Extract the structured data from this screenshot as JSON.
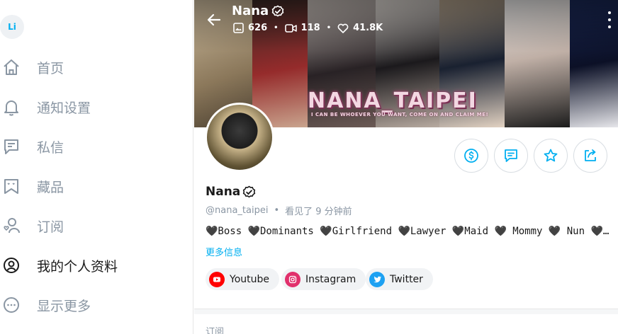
{
  "sidebar": {
    "avatar_initials": "Li",
    "items": [
      {
        "label": "首页",
        "icon": "home-icon"
      },
      {
        "label": "通知设置",
        "icon": "bell-icon"
      },
      {
        "label": "私信",
        "icon": "message-icon"
      },
      {
        "label": "藏品",
        "icon": "collections-icon"
      },
      {
        "label": "订阅",
        "icon": "subscriptions-icon"
      },
      {
        "label": "我的个人资料",
        "icon": "profile-icon"
      },
      {
        "label": "显示更多",
        "icon": "more-icon"
      }
    ]
  },
  "header": {
    "name": "Nana",
    "stats": {
      "photos": "626",
      "videos": "118",
      "likes": "41.8K"
    }
  },
  "banner": {
    "title": "NANA_TAIPEI",
    "subtitle": "I CAN BE WHOEVER YOU WANT, COME ON AND CLAIM ME!"
  },
  "profile": {
    "name": "Nana",
    "handle": "@nana_taipei",
    "separator": "•",
    "last_seen": "看见了  9 分钟前",
    "bio": "🖤Boss 🖤Dominants 🖤Girlfriend 🖤Lawyer 🖤Maid 🖤 Mommy 🖤 Nun 🖤…",
    "more_info": "更多信息"
  },
  "actions": [
    {
      "name": "tip-button",
      "icon": "dollar-icon"
    },
    {
      "name": "message-button",
      "icon": "message-icon"
    },
    {
      "name": "favorite-button",
      "icon": "star-icon"
    },
    {
      "name": "share-button",
      "icon": "share-icon"
    }
  ],
  "social": [
    {
      "label": "Youtube",
      "icon": "youtube-icon",
      "color": "#ff0000"
    },
    {
      "label": "Instagram",
      "icon": "instagram-icon",
      "color": "#e1306c"
    },
    {
      "label": "Twitter",
      "icon": "twitter-icon",
      "color": "#1da1f2"
    }
  ],
  "subscriptions_label": "订阅",
  "colors": {
    "accent": "#00aff0",
    "muted": "#8a96a3"
  }
}
